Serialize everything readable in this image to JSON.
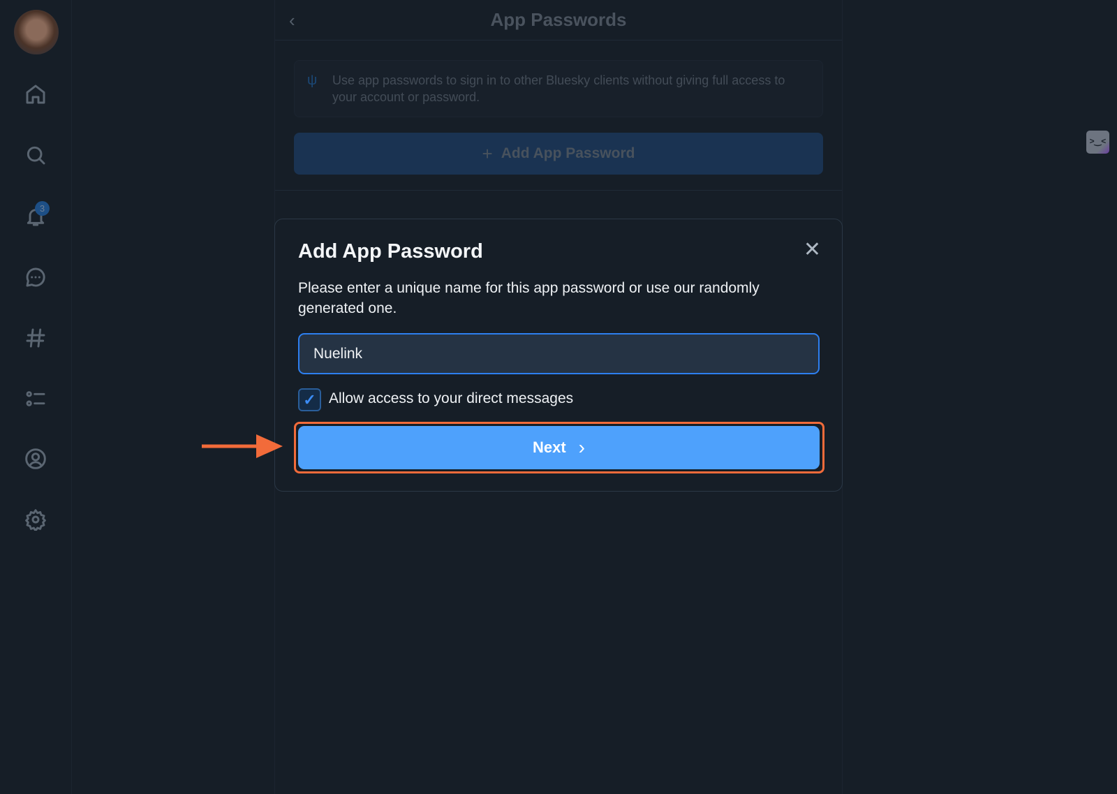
{
  "sidebar": {
    "notification_count": "3",
    "items": [
      "home",
      "search",
      "notifications",
      "chat",
      "feeds",
      "lists",
      "profile",
      "settings"
    ]
  },
  "header": {
    "title": "App Passwords",
    "back_icon": "‹"
  },
  "info": {
    "icon": "sprout-icon",
    "text": "Use app passwords to sign in to other Bluesky clients without giving full access to your account or password."
  },
  "add_button": {
    "icon": "+",
    "label": "Add App Password"
  },
  "modal": {
    "title": "Add App Password",
    "close_icon": "✕",
    "description": "Please enter a unique name for this app password or use our randomly generated one.",
    "name_value": "Nuelink",
    "checkbox_checked": true,
    "checkbox_mark": "✓",
    "checkbox_label": "Allow access to your direct messages",
    "next_label": "Next",
    "next_icon": "›"
  },
  "colors": {
    "accent": "#4ea1fc",
    "highlight": "#f26b3a",
    "background": "#161e27"
  },
  "fab": {
    "icon": ">‿<"
  }
}
